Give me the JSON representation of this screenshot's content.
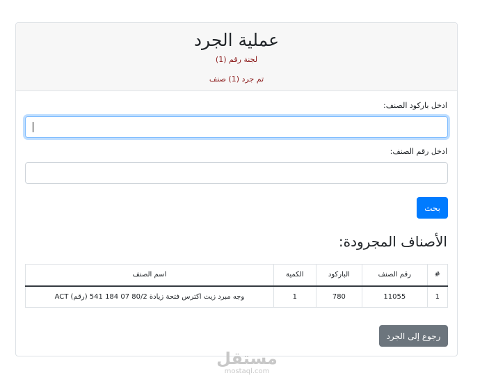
{
  "header": {
    "title": "عملية الجرد",
    "committee": "لجنة رقم (1)",
    "counted": "تم جرد (1) صنف"
  },
  "form": {
    "barcode_label": ":ادخل باركود الصنف",
    "barcode_value": "",
    "item_number_label": ":ادخل رقم الصنف",
    "item_number_value": "",
    "search_button": "بحث"
  },
  "inventory": {
    "section_title": ":الأصناف المجرودة",
    "columns": [
      "اسم الصنف",
      "الكمية",
      "الباركود",
      "رقم الصنف",
      "#"
    ],
    "rows": [
      {
        "name": "ACT (رقم) وجه مبرد زيت اكترس فتحة زيادة 80/2 07 184 541",
        "quantity": "1",
        "barcode": "780",
        "item_number": "11055",
        "index": "1"
      }
    ]
  },
  "footer": {
    "back_button": "رجوع إلى الجرد"
  },
  "watermark": {
    "arabic": "مستقل",
    "latin": "mostaql.com"
  },
  "colors": {
    "primary": "#007bff",
    "secondary": "#6c757d",
    "header_text": "#8b1a1a"
  }
}
